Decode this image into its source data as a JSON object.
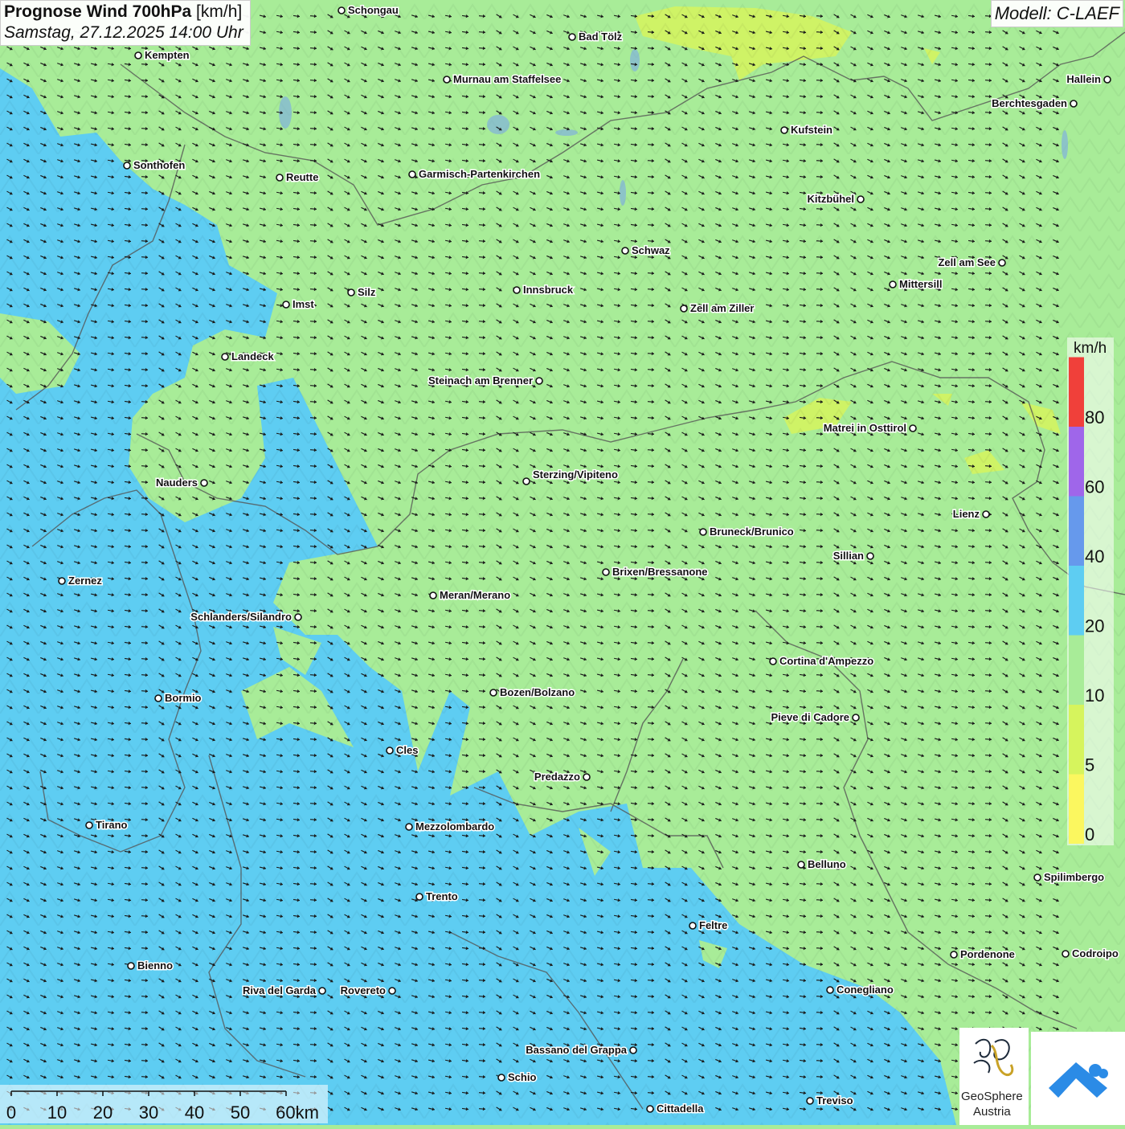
{
  "header": {
    "title_bold": "Prognose Wind 700hPa",
    "title_unit": "[km/h]",
    "datetime": "Samstag, 27.12.2025 14:00 Uhr",
    "model": "Modell: C-LAEF"
  },
  "legend": {
    "unit": "km/h",
    "bins": [
      {
        "label": "0",
        "color": "#fbf75f"
      },
      {
        "label": "5",
        "color": "#d6f45d"
      },
      {
        "label": "10",
        "color": "#a8ec98"
      },
      {
        "label": "20",
        "color": "#5ecdf2"
      },
      {
        "label": "40",
        "color": "#6699ec"
      },
      {
        "label": "60",
        "color": "#9f66ea"
      },
      {
        "label": "80",
        "color": "#f0403a"
      }
    ]
  },
  "scale": {
    "ticks": [
      "0",
      "10",
      "20",
      "30",
      "40",
      "50",
      "60km"
    ]
  },
  "cities": [
    {
      "name": "Schongau"
    },
    {
      "name": "Bad Tölz"
    },
    {
      "name": "Kempten"
    },
    {
      "name": "Murnau am Staffelsee"
    },
    {
      "name": "Hallein"
    },
    {
      "name": "Berchtesgaden"
    },
    {
      "name": "Kufstein"
    },
    {
      "name": "Sonthofen"
    },
    {
      "name": "Reutte"
    },
    {
      "name": "Garmisch-Partenkirchen"
    },
    {
      "name": "Kitzbühel"
    },
    {
      "name": "Schwaz"
    },
    {
      "name": "Zell am See"
    },
    {
      "name": "Mittersill"
    },
    {
      "name": "Innsbruck"
    },
    {
      "name": "Silz"
    },
    {
      "name": "Imst"
    },
    {
      "name": "Zell am Ziller"
    },
    {
      "name": "Landeck"
    },
    {
      "name": "Steinach am Brenner"
    },
    {
      "name": "Matrei in Osttirol"
    },
    {
      "name": "Nauders"
    },
    {
      "name": "Sterzing/Vipiteno"
    },
    {
      "name": "Lienz"
    },
    {
      "name": "Bruneck/Brunico"
    },
    {
      "name": "Sillian"
    },
    {
      "name": "Zernez"
    },
    {
      "name": "Brixen/Bressanone"
    },
    {
      "name": "Meran/Merano"
    },
    {
      "name": "Schlanders/Silandro"
    },
    {
      "name": "Cortina d'Ampezzo"
    },
    {
      "name": "Bozen/Bolzano"
    },
    {
      "name": "Bormio"
    },
    {
      "name": "Pieve di Cadore"
    },
    {
      "name": "Cles"
    },
    {
      "name": "Predazzo"
    },
    {
      "name": "Tirano"
    },
    {
      "name": "Mezzolombardo"
    },
    {
      "name": "Belluno"
    },
    {
      "name": "Spilimbergo"
    },
    {
      "name": "Trento"
    },
    {
      "name": "Feltre"
    },
    {
      "name": "Pordenone"
    },
    {
      "name": "Codroipo"
    },
    {
      "name": "Bienno"
    },
    {
      "name": "Riva del Garda"
    },
    {
      "name": "Rovereto"
    },
    {
      "name": "Conegliano"
    },
    {
      "name": "Bassano del Grappa"
    },
    {
      "name": "Schio"
    },
    {
      "name": "Treviso"
    },
    {
      "name": "Cittadella"
    }
  ],
  "logos": {
    "geosphere_line1": "GeoSphere",
    "geosphere_line2": "Austria"
  },
  "colors": {
    "green_zone": "#a8ec98",
    "blue_zone": "#5ecdf2",
    "yellow_zone": "#d6f45d",
    "arrow": "#1a1a1a",
    "border": "#555555",
    "lake": "#7aa8e8"
  }
}
